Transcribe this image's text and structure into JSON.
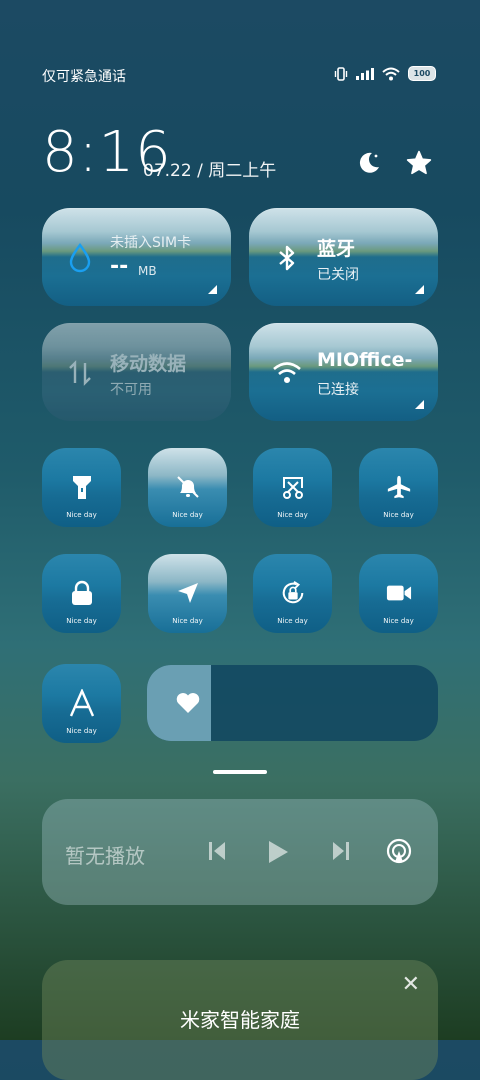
{
  "status": {
    "left_text": "仅可紧急通话",
    "battery": "100"
  },
  "clock": {
    "time": "8:16",
    "date": "07.22 / 周二上午"
  },
  "top_icons": [
    "moon-icon",
    "star-icon"
  ],
  "big_tiles": {
    "data": {
      "title": "未插入SIM卡",
      "value": "--",
      "unit": "MB"
    },
    "bluetooth": {
      "title": "蓝牙",
      "sub": "已关闭"
    },
    "mobile_data": {
      "title": "移动数据",
      "sub": "不可用"
    },
    "wifi": {
      "title": "MIOffice-",
      "sub": "已连接"
    }
  },
  "tiles": [
    {
      "icon": "flashlight-icon",
      "label": "Nice day"
    },
    {
      "icon": "mute-bell-icon",
      "label": "Nice day"
    },
    {
      "icon": "screenshot-icon",
      "label": "Nice day"
    },
    {
      "icon": "airplane-icon",
      "label": "Nice day"
    },
    {
      "icon": "lock-icon",
      "label": "Nice day"
    },
    {
      "icon": "location-icon",
      "label": "Nice day"
    },
    {
      "icon": "rotation-lock-icon",
      "label": "Nice day"
    },
    {
      "icon": "video-camera-icon",
      "label": "Nice day"
    },
    {
      "icon": "font-a-icon",
      "label": "Nice day"
    }
  ],
  "brightness": {
    "level_percent": 22
  },
  "media": {
    "text": "暂无播放"
  },
  "smart_home": {
    "title": "米家智能家庭"
  }
}
